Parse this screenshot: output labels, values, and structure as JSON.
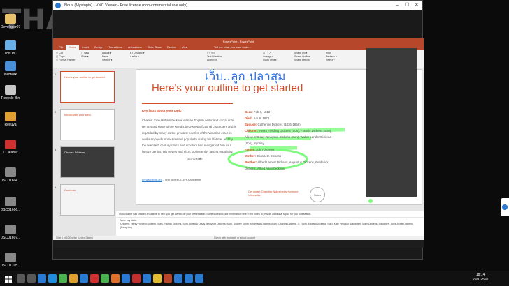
{
  "watermark": "THAIWARE",
  "desktop_icons": [
    {
      "label": "Developer07",
      "color": "#e8c26a"
    },
    {
      "label": "This PC",
      "color": "#6ab0e8"
    },
    {
      "label": "Network",
      "color": "#4a90d8"
    },
    {
      "label": "Recycle Bin",
      "color": "#c8c8c8"
    },
    {
      "label": "Recuva",
      "color": "#e0a030"
    },
    {
      "label": "CCleaner",
      "color": "#d03030"
    },
    {
      "label": "DSC01604...",
      "color": "#888888"
    },
    {
      "label": "DSC01606...",
      "color": "#888888"
    },
    {
      "label": "DSC01607...",
      "color": "#888888"
    },
    {
      "label": "DSC01705...",
      "color": "#888888"
    }
  ],
  "vnc": {
    "title": "Nous (Mystopia) - VNC Viewer - Free license (non-commercial use only)"
  },
  "ppt": {
    "title": "PowerPoint - PowerPoint",
    "tabs": [
      "File",
      "Home",
      "Insert",
      "Design",
      "Transitions",
      "Animations",
      "Slide Show",
      "Review",
      "View"
    ],
    "tell_me": "Tell me what you want to do...",
    "thumbs": [
      {
        "n": "1",
        "title": "Here's your outline to get started"
      },
      {
        "n": "2",
        "title": "Introducing your topic"
      },
      {
        "n": "3",
        "title": "Charles Dickens"
      },
      {
        "n": "4",
        "title": "Contents"
      },
      {
        "n": "5",
        "title": "Early years"
      }
    ],
    "slide": {
      "handwriting": "เว็บ..ลูก ปลาสุม",
      "heading": "Here's your outline to get started",
      "subheading": "Key facts about your topic",
      "para": "Charles John Huffam Dickens was an English writer and social critic. He created some of the world's best-known fictional characters and is regarded by many as the greatest novelist of the Victorian era. His works enjoyed unprecedented popularity during his lifetime, and by the twentieth century critics and scholars had recognized him as a literary genius. His novels and short stories enjoy lasting popularity.",
      "circle_note": "ลงลายมือชื่อ",
      "link": "en.wikipedia.org",
      "link_text": " - Text under CC-BY-SA license",
      "facts": [
        {
          "k": "Born:",
          "v": " Feb 7, 1812"
        },
        {
          "k": "Died:",
          "v": " Jun 9, 1870"
        },
        {
          "k": "Spouse:",
          "v": " Catherine Dickens (1836-1858)"
        },
        {
          "k": "Children:",
          "v": " Henry Fielding Dickens (Son), Francis Dickens (Son), Alfred D'Orsay Tennyson Dickens (Son), Walter Landor Dickens (Son), Sydney..."
        },
        {
          "k": "Father:",
          "v": " John Dickens"
        },
        {
          "k": "Mother:",
          "v": " Elizabeth Dickens"
        },
        {
          "k": "Brother:",
          "v": " Alfred Lamert Dickens, Augustus Dickens, Frederick Dickens, Alfred Allen Dickens"
        }
      ],
      "tip": "Get smart: Open the Notes below for more information",
      "notes_btn": "Notes"
    },
    "notes_bar": "QuickStarter has created an outline to help you get started on your presentation. Some slides include information here in the notes to provide additional topics for you to research.",
    "notes_text": "More key facts:",
    "notes_children": "Children: Henry Fielding Dickens (Son), Francis Dickens (Son), Alfred D'Orsay Tennyson Dickens (Son), Sydney Smith Haldimand Dickens (Son), Charles Dickens, Jr. (Son), Edward Dickens (Son), Kate Perugini (Daughter), Mary Dickens (Daughter), Dora Annie Dickens (Daughter)",
    "status": "Slide 1 of 10    English (United States)",
    "statusbar_right": "Sign in with your work or school account"
  },
  "clock": {
    "time": "18:14",
    "date": "29/1/2560"
  },
  "colors": {
    "accent": "#b7472a",
    "heading": "#d54b27",
    "highlight": "#7CFC7C",
    "ink": "#3a6ee8"
  }
}
